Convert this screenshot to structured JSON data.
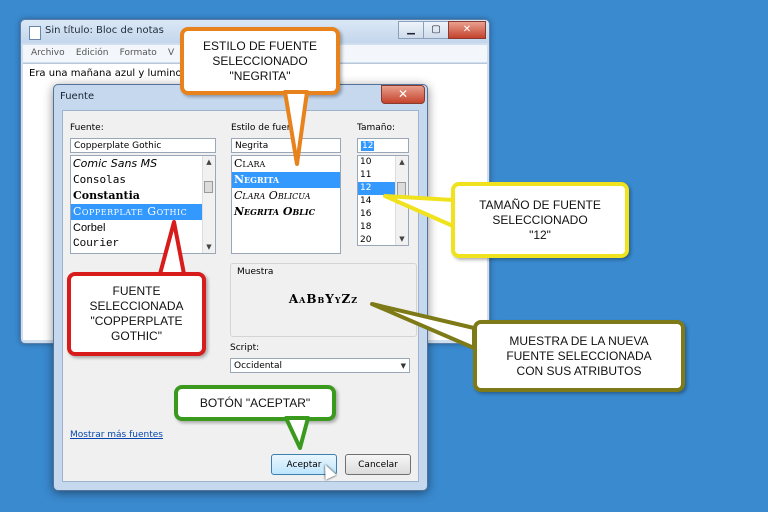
{
  "notepad": {
    "title": "Sin título: Bloc de notas",
    "menu": [
      "Archivo",
      "Edición",
      "Formato",
      "V"
    ],
    "text": "Era una mañana azul y lumino"
  },
  "dialog": {
    "title": "Fuente",
    "close_label": "✕",
    "font": {
      "label": "Fuente:",
      "value": "Copperplate Gothic",
      "items": [
        "Comic Sans MS",
        "Consolas",
        "Constantia",
        "Copperplate Gothic",
        "Corbel",
        "Courier"
      ],
      "selected_index": 3
    },
    "style": {
      "label": "Estilo de fuente",
      "value": "Negrita",
      "items": [
        "Clara",
        "Negrita",
        "Clara Oblicua",
        "Negrita Oblic"
      ],
      "selected_index": 1
    },
    "size": {
      "label": "Tamaño:",
      "value": "12",
      "items": [
        "10",
        "11",
        "12",
        "14",
        "16",
        "18",
        "20"
      ],
      "selected_index": 2
    },
    "sample": {
      "label": "Muestra",
      "text": "AaBbYyZz"
    },
    "script": {
      "label": "Script:",
      "value": "Occidental"
    },
    "more_fonts_link": "Mostrar más fuentes",
    "ok_label": "Aceptar",
    "cancel_label": "Cancelar"
  },
  "callouts": {
    "style": "ESTILO DE FUENTE\nSELECCIONADO\n\"NEGRITA\"",
    "size": "TAMAÑO DE FUENTE\nSELECCIONADO\n\"12\"",
    "font": "FUENTE\nSELECCIONADA\n\"COPPERPLATE\nGOTHIC\"",
    "sample": "MUESTRA DE LA NUEVA\nFUENTE SELECCIONADA\nCON SUS ATRIBUTOS",
    "ok": "BOTÓN  \"ACEPTAR\""
  },
  "colors": {
    "background": "#3a8ad0",
    "selection": "#3399ff",
    "callout_orange": "#e8821c",
    "callout_yellow": "#f0e21c",
    "callout_red": "#d81c1c",
    "callout_olive": "#7e7a17",
    "callout_green": "#3a9a1e"
  },
  "icons": {
    "notepad": "notepad-icon",
    "minimize": "minimize-icon",
    "maximize": "maximize-icon",
    "close": "close-icon",
    "dropdown": "chevron-down-icon",
    "cursor": "mouse-pointer-icon"
  }
}
